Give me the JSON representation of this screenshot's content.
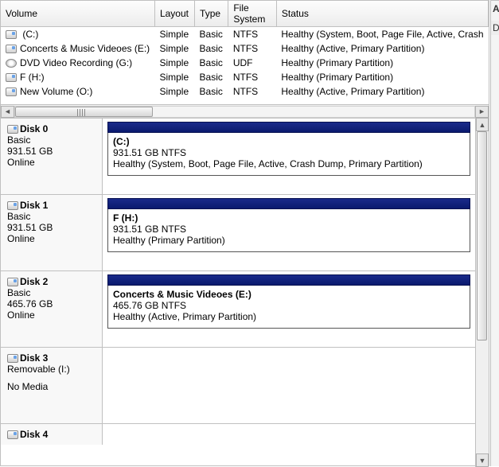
{
  "right_pane": {
    "title_initial": "A",
    "row_initial": "Di"
  },
  "columns": {
    "volume": "Volume",
    "layout": "Layout",
    "type": "Type",
    "filesystem": "File System",
    "status": "Status"
  },
  "volumes": [
    {
      "icon": "drive",
      "name": " (C:)",
      "layout": "Simple",
      "type": "Basic",
      "fs": "NTFS",
      "status": "Healthy (System, Boot, Page File, Active, Crash"
    },
    {
      "icon": "drive",
      "name": "Concerts & Music Videoes (E:)",
      "layout": "Simple",
      "type": "Basic",
      "fs": "NTFS",
      "status": "Healthy (Active, Primary Partition)"
    },
    {
      "icon": "dvd",
      "name": "DVD Video Recording (G:)",
      "layout": "Simple",
      "type": "Basic",
      "fs": "UDF",
      "status": "Healthy (Primary Partition)"
    },
    {
      "icon": "drive",
      "name": "F (H:)",
      "layout": "Simple",
      "type": "Basic",
      "fs": "NTFS",
      "status": "Healthy (Primary Partition)"
    },
    {
      "icon": "drive",
      "name": "New Volume (O:)",
      "layout": "Simple",
      "type": "Basic",
      "fs": "NTFS",
      "status": "Healthy (Active, Primary Partition)"
    }
  ],
  "disks": [
    {
      "name": "Disk 0",
      "kind": "Basic",
      "size": "931.51 GB",
      "state": "Online",
      "part_name": " (C:)",
      "part_size": "931.51 GB NTFS",
      "part_status": "Healthy (System, Boot, Page File, Active, Crash Dump, Primary Partition)"
    },
    {
      "name": "Disk 1",
      "kind": "Basic",
      "size": "931.51 GB",
      "state": "Online",
      "part_name": "F  (H:)",
      "part_size": "931.51 GB NTFS",
      "part_status": "Healthy (Primary Partition)"
    },
    {
      "name": "Disk 2",
      "kind": "Basic",
      "size": "465.76 GB",
      "state": "Online",
      "part_name": "Concerts & Music Videoes  (E:)",
      "part_size": "465.76 GB NTFS",
      "part_status": "Healthy (Active, Primary Partition)"
    },
    {
      "name": "Disk 3",
      "kind": "Removable (I:)",
      "size": "",
      "state": "No Media",
      "part_name": "",
      "part_size": "",
      "part_status": ""
    },
    {
      "name": "Disk 4",
      "kind": "",
      "size": "",
      "state": "",
      "part_name": "",
      "part_size": "",
      "part_status": ""
    }
  ]
}
